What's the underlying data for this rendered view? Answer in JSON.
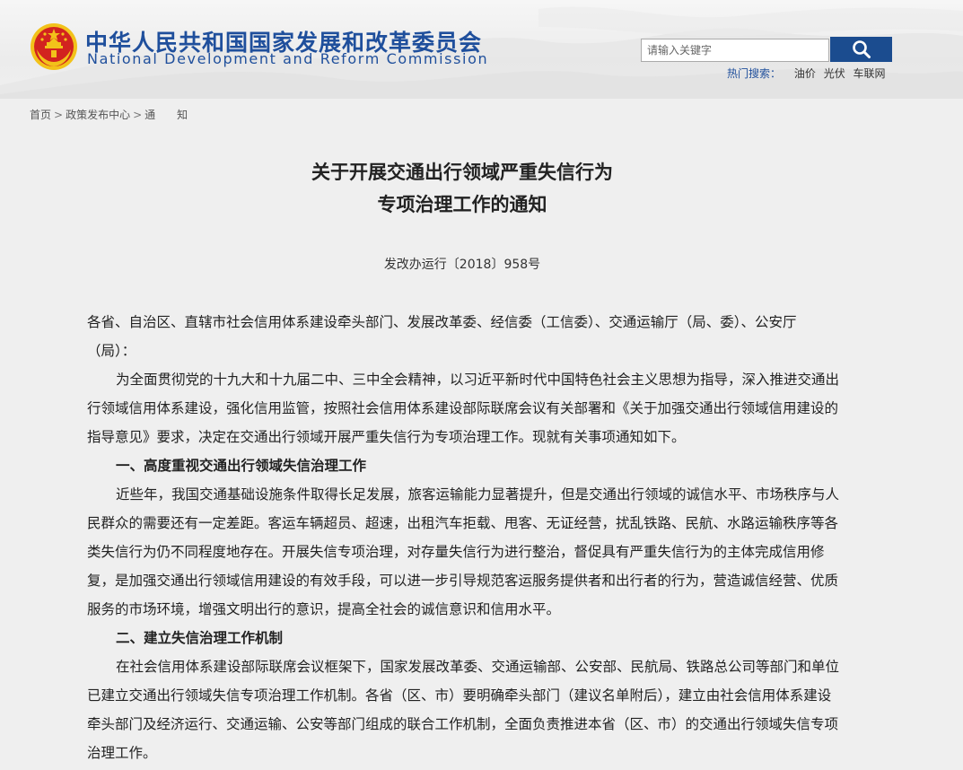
{
  "site": {
    "name_cn": "中华人民共和国国家发展和改革委员会",
    "name_en": "National Development and Reform Commission",
    "emblem_icon": "national-emblem-icon"
  },
  "search": {
    "placeholder": "请输入关键字",
    "button_icon": "search-icon",
    "hot_label": "热门搜索：",
    "hot_terms": [
      "油价",
      "光伏",
      "车联网"
    ]
  },
  "breadcrumb": {
    "items": [
      "首页",
      "政策发布中心",
      "通　　知"
    ],
    "separator": ">"
  },
  "article": {
    "title_line1": "关于开展交通出行领域严重失信行为",
    "title_line2": "专项治理工作的通知",
    "doc_number": "发改办运行〔2018〕958号",
    "addressee": "各省、自治区、直辖市社会信用体系建设牵头部门、发展改革委、经信委（工信委）、交通运输厅（局、委）、公安厅（局）：",
    "intro": "为全面贯彻党的十九大和十九届二中、三中全会精神，以习近平新时代中国特色社会主义思想为指导，深入推进交通出行领域信用体系建设，强化信用监管，按照社会信用体系建设部际联席会议有关部署和《关于加强交通出行领域信用建设的指导意见》要求，决定在交通出行领域开展严重失信行为专项治理工作。现就有关事项通知如下。",
    "section1_heading": "一、高度重视交通出行领域失信治理工作",
    "section1_body": "近些年，我国交通基础设施条件取得长足发展，旅客运输能力显著提升，但是交通出行领域的诚信水平、市场秩序与人民群众的需要还有一定差距。客运车辆超员、超速，出租汽车拒载、甩客、无证经营，扰乱铁路、民航、水路运输秩序等各类失信行为仍不同程度地存在。开展失信专项治理，对存量失信行为进行整治，督促具有严重失信行为的主体完成信用修复，是加强交通出行领域信用建设的有效手段，可以进一步引导规范客运服务提供者和出行者的行为，营造诚信经营、优质服务的市场环境，增强文明出行的意识，提高全社会的诚信意识和信用水平。",
    "section2_heading": "二、建立失信治理工作机制",
    "section2_body": "在社会信用体系建设部际联席会议框架下，国家发展改革委、交通运输部、公安部、民航局、铁路总公司等部门和单位已建立交通出行领域失信专项治理工作机制。各省（区、市）要明确牵头部门（建议名单附后），建立由社会信用体系建设牵头部门及经济运行、交通运输、公安等部门组成的联合工作机制，全面负责推进本省（区、市）的交通出行领域失信专项治理工作。"
  },
  "colors": {
    "brand_blue": "#1f4f9c",
    "search_button": "#1b4c8f",
    "emblem_red": "#d2231f",
    "emblem_gold": "#f2c21a"
  }
}
